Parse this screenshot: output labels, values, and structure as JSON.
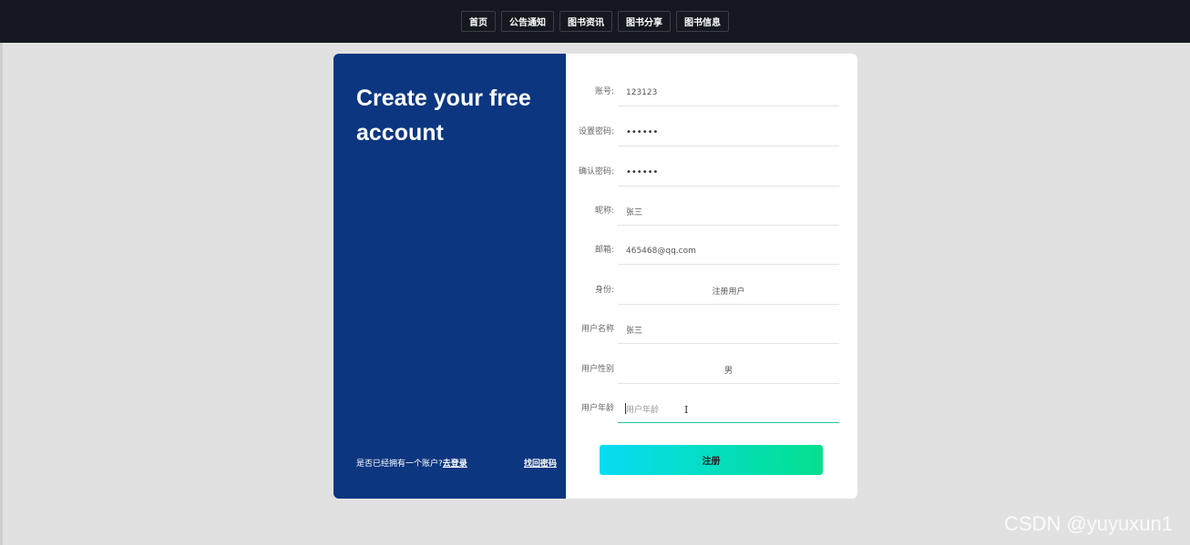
{
  "nav": {
    "items": [
      "首页",
      "公告通知",
      "图书资讯",
      "图书分享",
      "图书信息"
    ]
  },
  "card": {
    "title": "Create your free account",
    "footer_prompt": "是否已经拥有一个账户?",
    "login_link": "去登录",
    "forgot_link": "找回密码"
  },
  "form": {
    "fields": [
      {
        "label": "账号:",
        "value": "123123"
      },
      {
        "label": "设置密码:",
        "value": "••••••"
      },
      {
        "label": "确认密码:",
        "value": "••••••"
      },
      {
        "label": "昵称:",
        "value": "张三"
      },
      {
        "label": "邮箱:",
        "value": "465468@qq.com"
      },
      {
        "label": "身份:",
        "value": "注册用户"
      },
      {
        "label": "用户名称",
        "value": "张三"
      },
      {
        "label": "用户性别",
        "value": "男"
      },
      {
        "label": "用户年龄",
        "value": "",
        "placeholder": "用户年龄"
      }
    ],
    "submit_label": "注册"
  },
  "colors": {
    "topbar": "#15181e",
    "left_panel": "#0c3680",
    "button_gradient_start": "#06dcf4",
    "button_gradient_end": "#04e08e",
    "active_underline": "#25c49e"
  },
  "watermark": "CSDN @yuyuxun1"
}
